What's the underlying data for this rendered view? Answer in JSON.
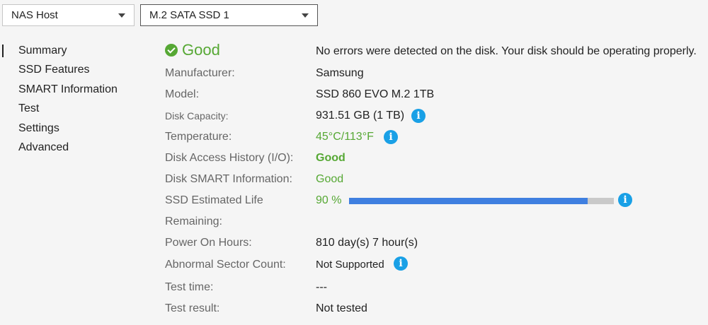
{
  "header": {
    "host_select": "NAS Host",
    "disk_select": "M.2 SATA SSD 1"
  },
  "sidebar": {
    "items": [
      {
        "label": "Summary"
      },
      {
        "label": "SSD Features"
      },
      {
        "label": "SMART Information"
      },
      {
        "label": "Test"
      },
      {
        "label": "Settings"
      },
      {
        "label": "Advanced"
      }
    ],
    "active": "Summary"
  },
  "status": {
    "label": "Good",
    "message": "No errors were detected on the disk. Your disk should be operating properly.",
    "color": "#56a834"
  },
  "details": {
    "manufacturer": {
      "label": "Manufacturer:",
      "value": "Samsung"
    },
    "model": {
      "label": "Model:",
      "value": "SSD 860 EVO M.2 1TB"
    },
    "capacity": {
      "label": "Disk Capacity:",
      "value": "931.51 GB (1 TB)"
    },
    "temperature": {
      "label": "Temperature:",
      "value": "45°C/113°F"
    },
    "access_history": {
      "label": "Disk Access History (I/O):",
      "value": "Good"
    },
    "smart_info": {
      "label": "Disk SMART Information:",
      "value": "Good"
    },
    "estimated_life": {
      "label_line1": "SSD Estimated Life",
      "label_line2": "Remaining:",
      "value": "90 %",
      "percent": 90
    },
    "power_on_hours": {
      "label": "Power On Hours:",
      "value": "810 day(s) 7 hour(s)"
    },
    "abnormal_sectors": {
      "label": "Abnormal Sector Count:",
      "value": "Not Supported"
    },
    "test_time": {
      "label": "Test time:",
      "value": "---"
    },
    "test_result": {
      "label": "Test result:",
      "value": "Not tested"
    }
  },
  "icons": {
    "info": "info-icon",
    "status": "check-circle-icon",
    "dropdown": "chevron-down-icon"
  },
  "colors": {
    "accent_green": "#56a834",
    "info_blue": "#19a0e6",
    "bar_fill": "#3f7fe0",
    "bar_track": "#c9c9c9"
  }
}
